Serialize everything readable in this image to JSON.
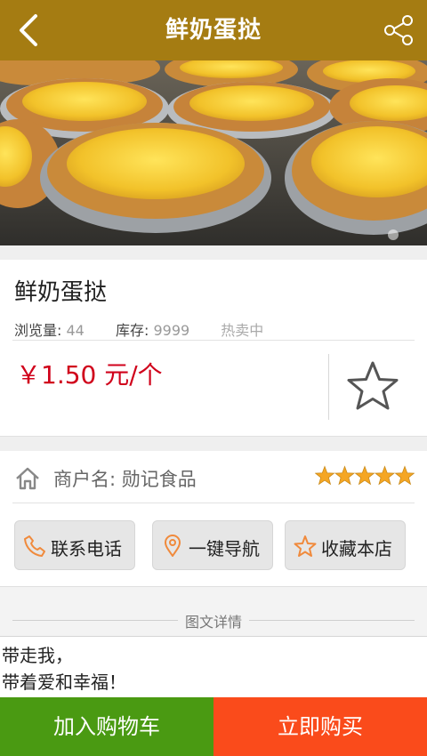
{
  "header": {
    "title": "鲜奶蛋挞",
    "back_icon": "chevron-left-icon",
    "share_icon": "share-icon"
  },
  "product": {
    "name": "鲜奶蛋挞",
    "views_label": "浏览量:",
    "views_value": "44",
    "stock_label": "库存:",
    "stock_value": "9999",
    "status": "热卖中",
    "price": "￥1.50 元/个",
    "favorite_icon": "star-outline-icon"
  },
  "merchant": {
    "label": "商户名:",
    "name": "勋记食品",
    "rating": 5,
    "rating_max": 5,
    "buttons": [
      {
        "label": "联系电话",
        "icon": "phone-icon"
      },
      {
        "label": "一键导航",
        "icon": "location-pin-icon"
      },
      {
        "label": "收藏本店",
        "icon": "star-outline-icon"
      }
    ]
  },
  "detail": {
    "tab_title": "图文详情",
    "lines": [
      "带走我，",
      "带着爱和幸福！"
    ]
  },
  "actions": {
    "add_to_cart": "加入购物车",
    "buy_now": "立即购买"
  },
  "colors": {
    "header": "#a57c12",
    "price": "#d0021b",
    "star": "#f5a623",
    "icon_accent": "#f08a3c",
    "cart_button": "#4a9a12",
    "buy_button": "#fa4b1b"
  }
}
